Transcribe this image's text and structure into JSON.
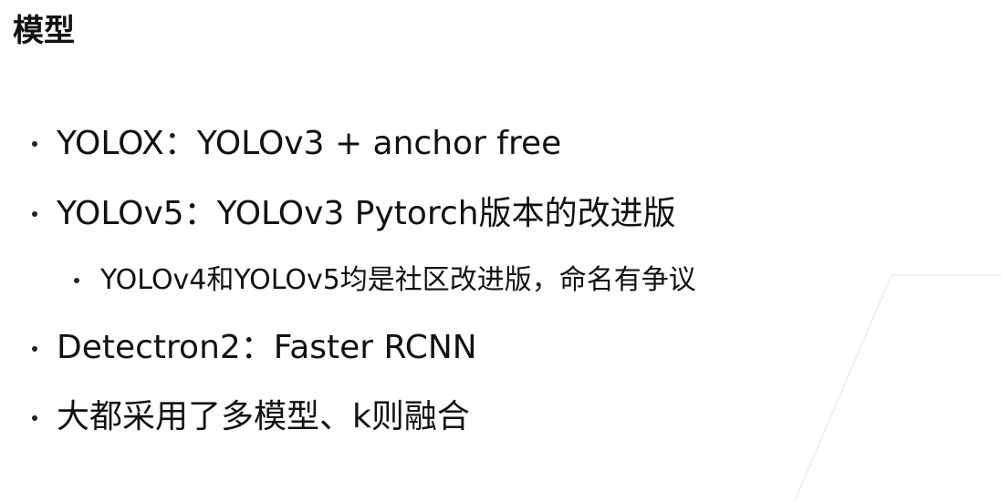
{
  "title": "模型",
  "bullets": [
    {
      "text": "YOLOX：YOLOv3 + anchor free",
      "level": 1
    },
    {
      "text": "YOLOv5：YOLOv3 Pytorch版本的改进版",
      "level": 1
    },
    {
      "text": "YOLOv4和YOLOv5均是社区改进版，命名有争议",
      "level": 2
    },
    {
      "text": "Detectron2：Faster RCNN",
      "level": 1
    },
    {
      "text": "大都采用了多模型、k则融合",
      "level": 1
    }
  ]
}
